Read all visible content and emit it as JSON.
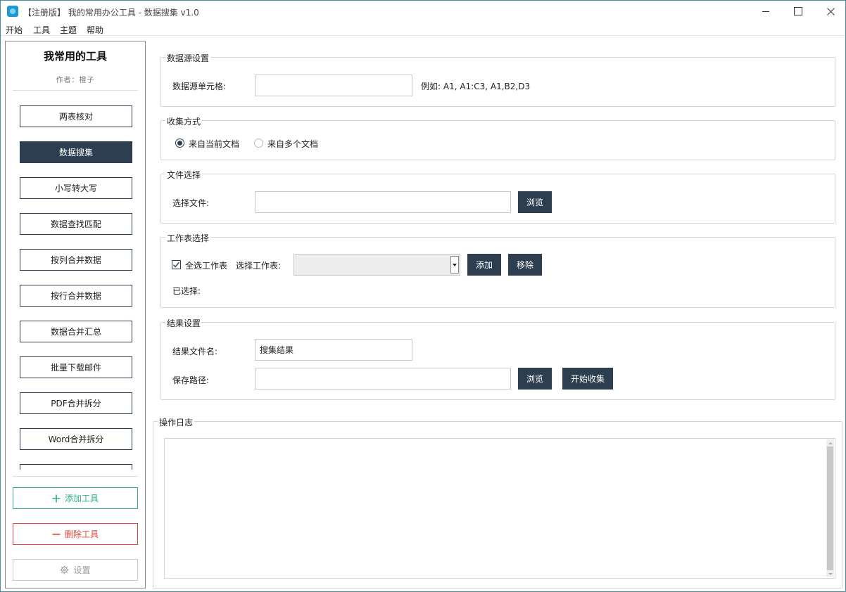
{
  "window": {
    "title": "【注册版】 我的常用办公工具 - 数据搜集 v1.0"
  },
  "menu": [
    "开始",
    "工具",
    "主题",
    "帮助"
  ],
  "sidebar": {
    "title": "我常用的工具",
    "author": "作者：橙子",
    "tools": [
      {
        "label": "两表核对",
        "active": false
      },
      {
        "label": "数据搜集",
        "active": true
      },
      {
        "label": "小写转大写",
        "active": false
      },
      {
        "label": "数据查找匹配",
        "active": false
      },
      {
        "label": "按列合并数据",
        "active": false
      },
      {
        "label": "按行合并数据",
        "active": false
      },
      {
        "label": "数据合并汇总",
        "active": false
      },
      {
        "label": "批量下载邮件",
        "active": false
      },
      {
        "label": "PDF合并拆分",
        "active": false
      },
      {
        "label": "Word合并拆分",
        "active": false
      },
      {
        "label": "",
        "active": false
      }
    ],
    "add_label": "添加工具",
    "delete_label": "删除工具",
    "settings_label": "设置"
  },
  "datasource": {
    "group_title": "数据源设置",
    "cell_label": "数据源单元格:",
    "cell_value": "",
    "example": "例如: A1, A1:C3, A1,B2,D3"
  },
  "collect": {
    "group_title": "收集方式",
    "options": [
      {
        "label": "来自当前文档",
        "checked": true
      },
      {
        "label": "来自多个文档",
        "checked": false
      }
    ]
  },
  "file": {
    "group_title": "文件选择",
    "label": "选择文件:",
    "value": "",
    "browse_label": "浏览"
  },
  "sheet": {
    "group_title": "工作表选择",
    "select_all_label": "全选工作表",
    "select_all_checked": true,
    "choose_label": "选择工作表:",
    "selected_value": "",
    "add_label": "添加",
    "remove_label": "移除",
    "selected_label": "已选择:"
  },
  "result": {
    "group_title": "结果设置",
    "filename_label": "结果文件名:",
    "filename_value": "搜集结果",
    "path_label": "保存路径:",
    "path_value": "",
    "browse_label": "浏览",
    "start_label": "开始收集"
  },
  "log": {
    "group_title": "操作日志",
    "content": ""
  },
  "colors": {
    "accent_dark": "#2c3e50",
    "add_green": "#2bae86",
    "delete_red": "#e0493b",
    "window_border": "#4a8ea8"
  }
}
